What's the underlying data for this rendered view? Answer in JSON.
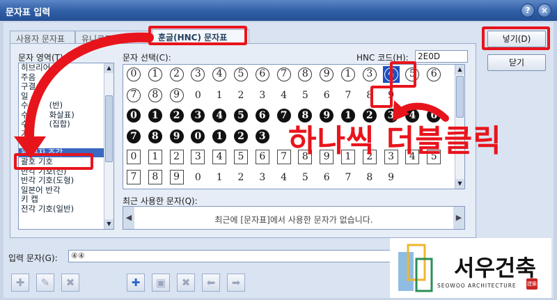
{
  "window": {
    "title": "문자표 입력",
    "help_btn": "?",
    "close_btn": "×"
  },
  "tabs": [
    "사용자 문자표",
    "유니코드 문자표",
    "훈글(HNC) 문자표"
  ],
  "area": {
    "label": "문자 영역(T):",
    "items": [
      "히브리어",
      "주음",
      "구결",
      "일",
      "수",
      "수",
      "수",
      "기",
      "기",
      "원 문자 조각",
      "괄호 기호",
      "반각 기호(선)",
      "반각 기호(도형)",
      "일본어 반각",
      "키 캡",
      "전각 기호(일반)"
    ],
    "peek": [
      "",
      "",
      "",
      "",
      "(반)",
      "화살표)",
      "(집합)",
      "",
      "",
      "",
      "",
      "",
      "",
      "",
      "",
      ""
    ]
  },
  "select_label": "문자 선택(C):",
  "hnc_label": "HNC 코드(H):",
  "hnc_code": "2E0D",
  "grid": {
    "rows": [
      {
        "style": "circ",
        "chars": [
          "0",
          "1",
          "2",
          "3",
          "4",
          "5",
          "6",
          "7",
          "8",
          "9",
          "1",
          "3",
          "4",
          "5",
          "6"
        ]
      },
      {
        "style": "mixed",
        "chars": [
          "7",
          "8",
          "9",
          "0",
          "1",
          "2",
          "3",
          "4",
          "5",
          "6",
          "7",
          "8",
          "9",
          "",
          ""
        ]
      },
      {
        "style": "fcirc",
        "chars": [
          "0",
          "1",
          "2",
          "3",
          "4",
          "5",
          "6",
          "7",
          "8",
          "9",
          "1",
          "2",
          "3",
          "4",
          "6"
        ]
      },
      {
        "style": "fcirc",
        "chars": [
          "7",
          "8",
          "9",
          "0",
          "1",
          "2",
          "3",
          "",
          "",
          "",
          "",
          "",
          "",
          "",
          ""
        ]
      },
      {
        "style": "sq",
        "chars": [
          "0",
          "1",
          "2",
          "3",
          "4",
          "5",
          "6",
          "7",
          "8",
          "9",
          "1",
          "2",
          "3",
          "4",
          "5"
        ]
      },
      {
        "style": "sq2",
        "chars": [
          "7",
          "8",
          "9",
          "0",
          "1",
          "2",
          "3",
          "4",
          "5",
          "6",
          "7",
          "8",
          "9",
          "",
          ""
        ]
      }
    ]
  },
  "recent": {
    "label": "최근 사용한 문자(Q):",
    "empty_text": "최근에 [문자표]에서 사용한 문자가 없습니다."
  },
  "input": {
    "label": "입력 문자(G):",
    "value": "④④"
  },
  "buttons": {
    "insert": "넣기(D)",
    "close": "닫기"
  },
  "annotation": "하나씩 더블클릭",
  "logo": {
    "name": "서우건축",
    "sub": "SEOWOO ARCHITECTURE",
    "seal": "建築"
  },
  "colors": {
    "annotation_red": "#e8141c",
    "selection_blue": "#1e4fbf"
  }
}
